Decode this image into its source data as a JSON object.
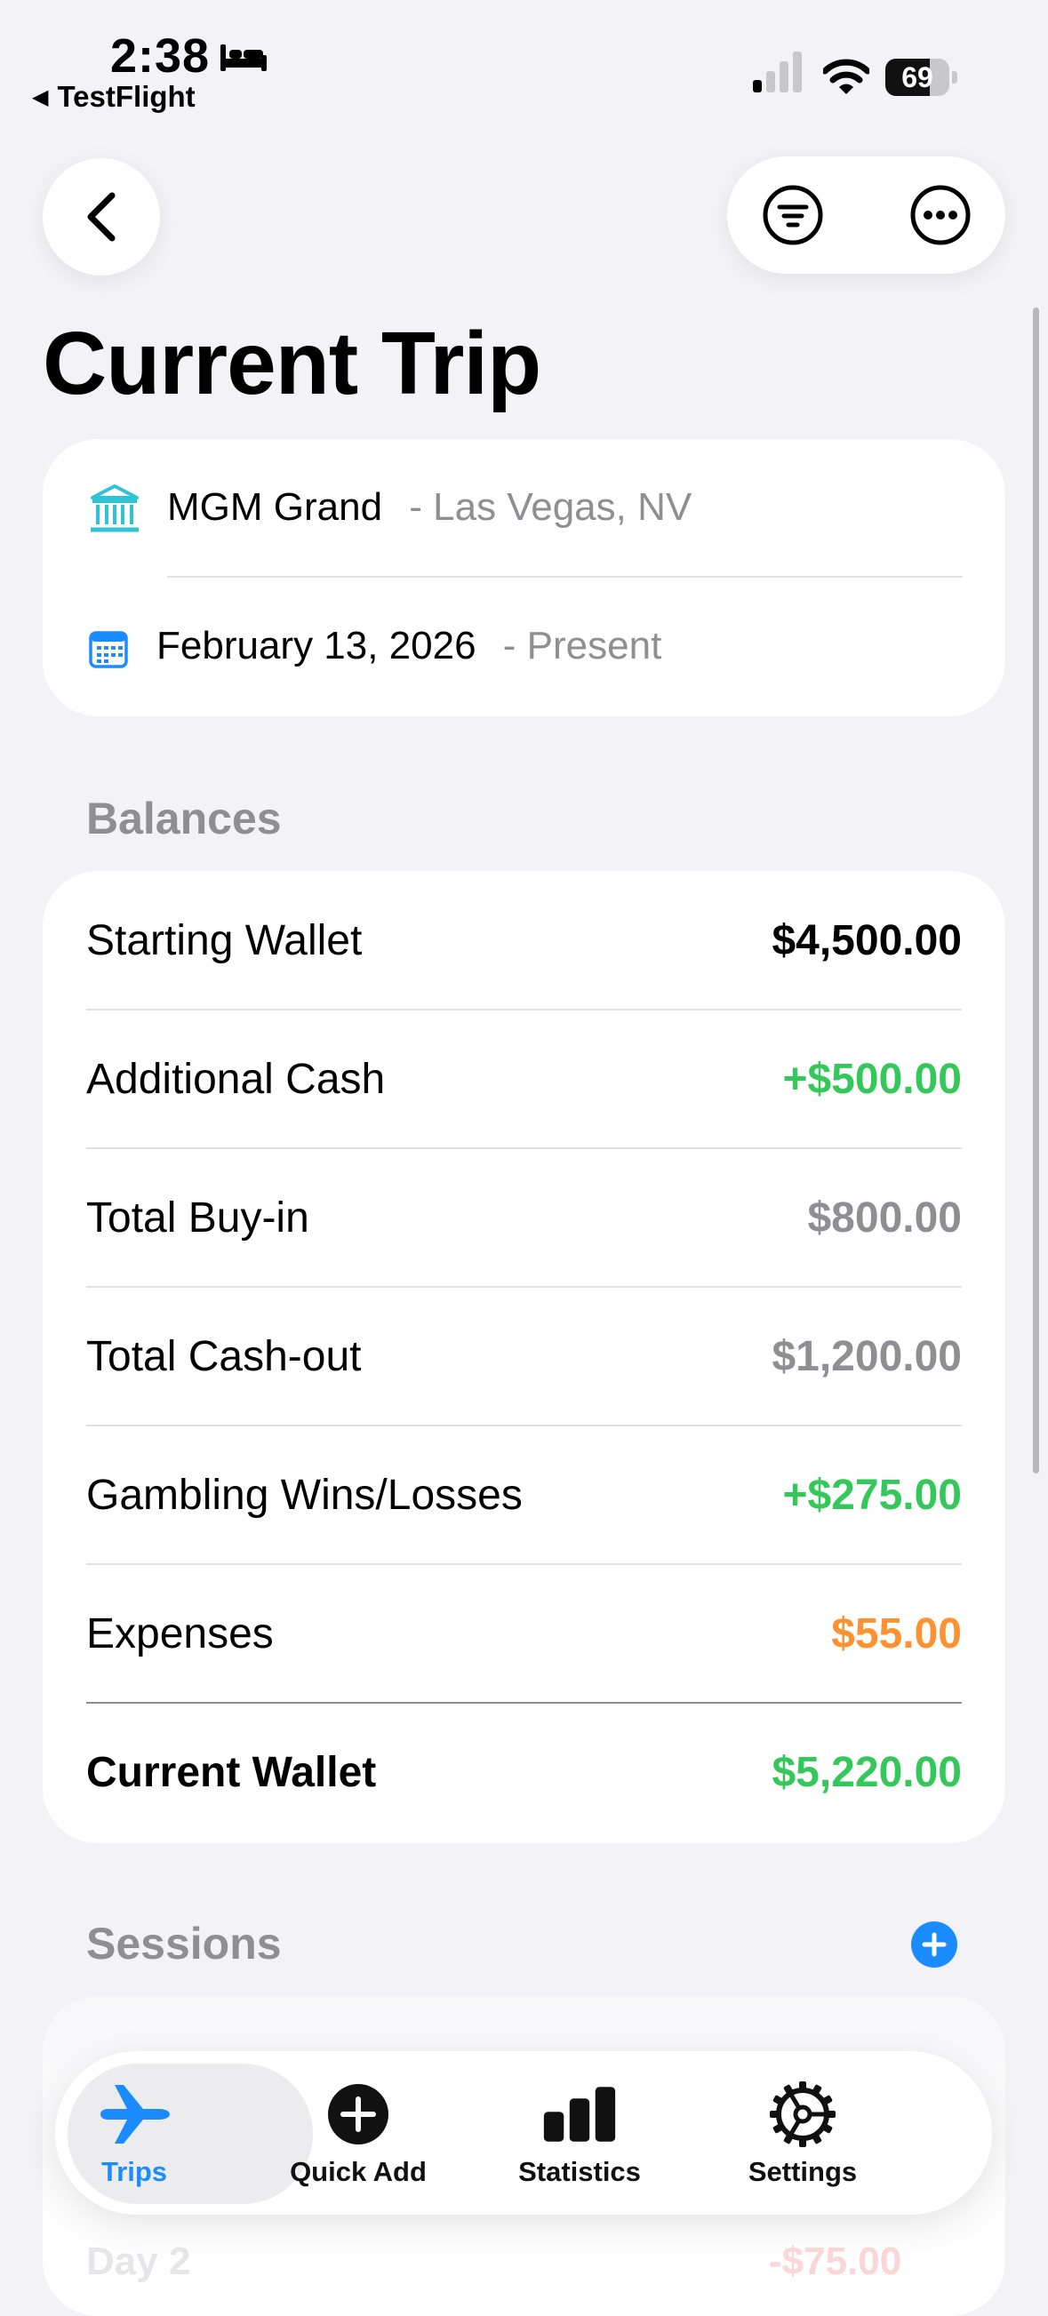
{
  "status_bar": {
    "time": "2:38",
    "back_app": "TestFlight",
    "battery": 69
  },
  "page": {
    "title": "Current Trip"
  },
  "trip": {
    "casino": "MGM Grand",
    "location": "- Las Vegas, NV",
    "start_date": "February 13, 2026",
    "end": "- Present"
  },
  "balances": {
    "section_label": "Balances",
    "rows": [
      {
        "label": "Starting Wallet",
        "value": "$4,500.00",
        "color": "#000000"
      },
      {
        "label": "Additional Cash",
        "value": "+$500.00",
        "color": "#34c759"
      },
      {
        "label": "Total Buy-in",
        "value": "$800.00",
        "color": "#8e8e93"
      },
      {
        "label": "Total Cash-out",
        "value": "$1,200.00",
        "color": "#8e8e93"
      },
      {
        "label": "Gambling Wins/Losses",
        "value": "+$275.00",
        "color": "#34c759"
      },
      {
        "label": "Expenses",
        "value": "$55.00",
        "color": "#ff9230"
      },
      {
        "label": "Current Wallet",
        "value": "$5,220.00",
        "color": "#34c759"
      }
    ]
  },
  "sessions": {
    "section_label": "Sessions",
    "partial_label": "Day 2",
    "partial_value": "-$75.00"
  },
  "tabbar": {
    "tabs": [
      {
        "label": "Trips",
        "icon": "airplane-icon",
        "active": true
      },
      {
        "label": "Quick Add",
        "icon": "plus-circle-icon",
        "active": false
      },
      {
        "label": "Statistics",
        "icon": "bar-chart-icon",
        "active": false
      },
      {
        "label": "Settings",
        "icon": "gear-icon",
        "active": false
      }
    ]
  },
  "colors": {
    "accent": "#1a8cff",
    "green": "#34c759",
    "orange": "#ff9230",
    "teal": "#2ec4d6",
    "background": "#f2f2f7"
  }
}
